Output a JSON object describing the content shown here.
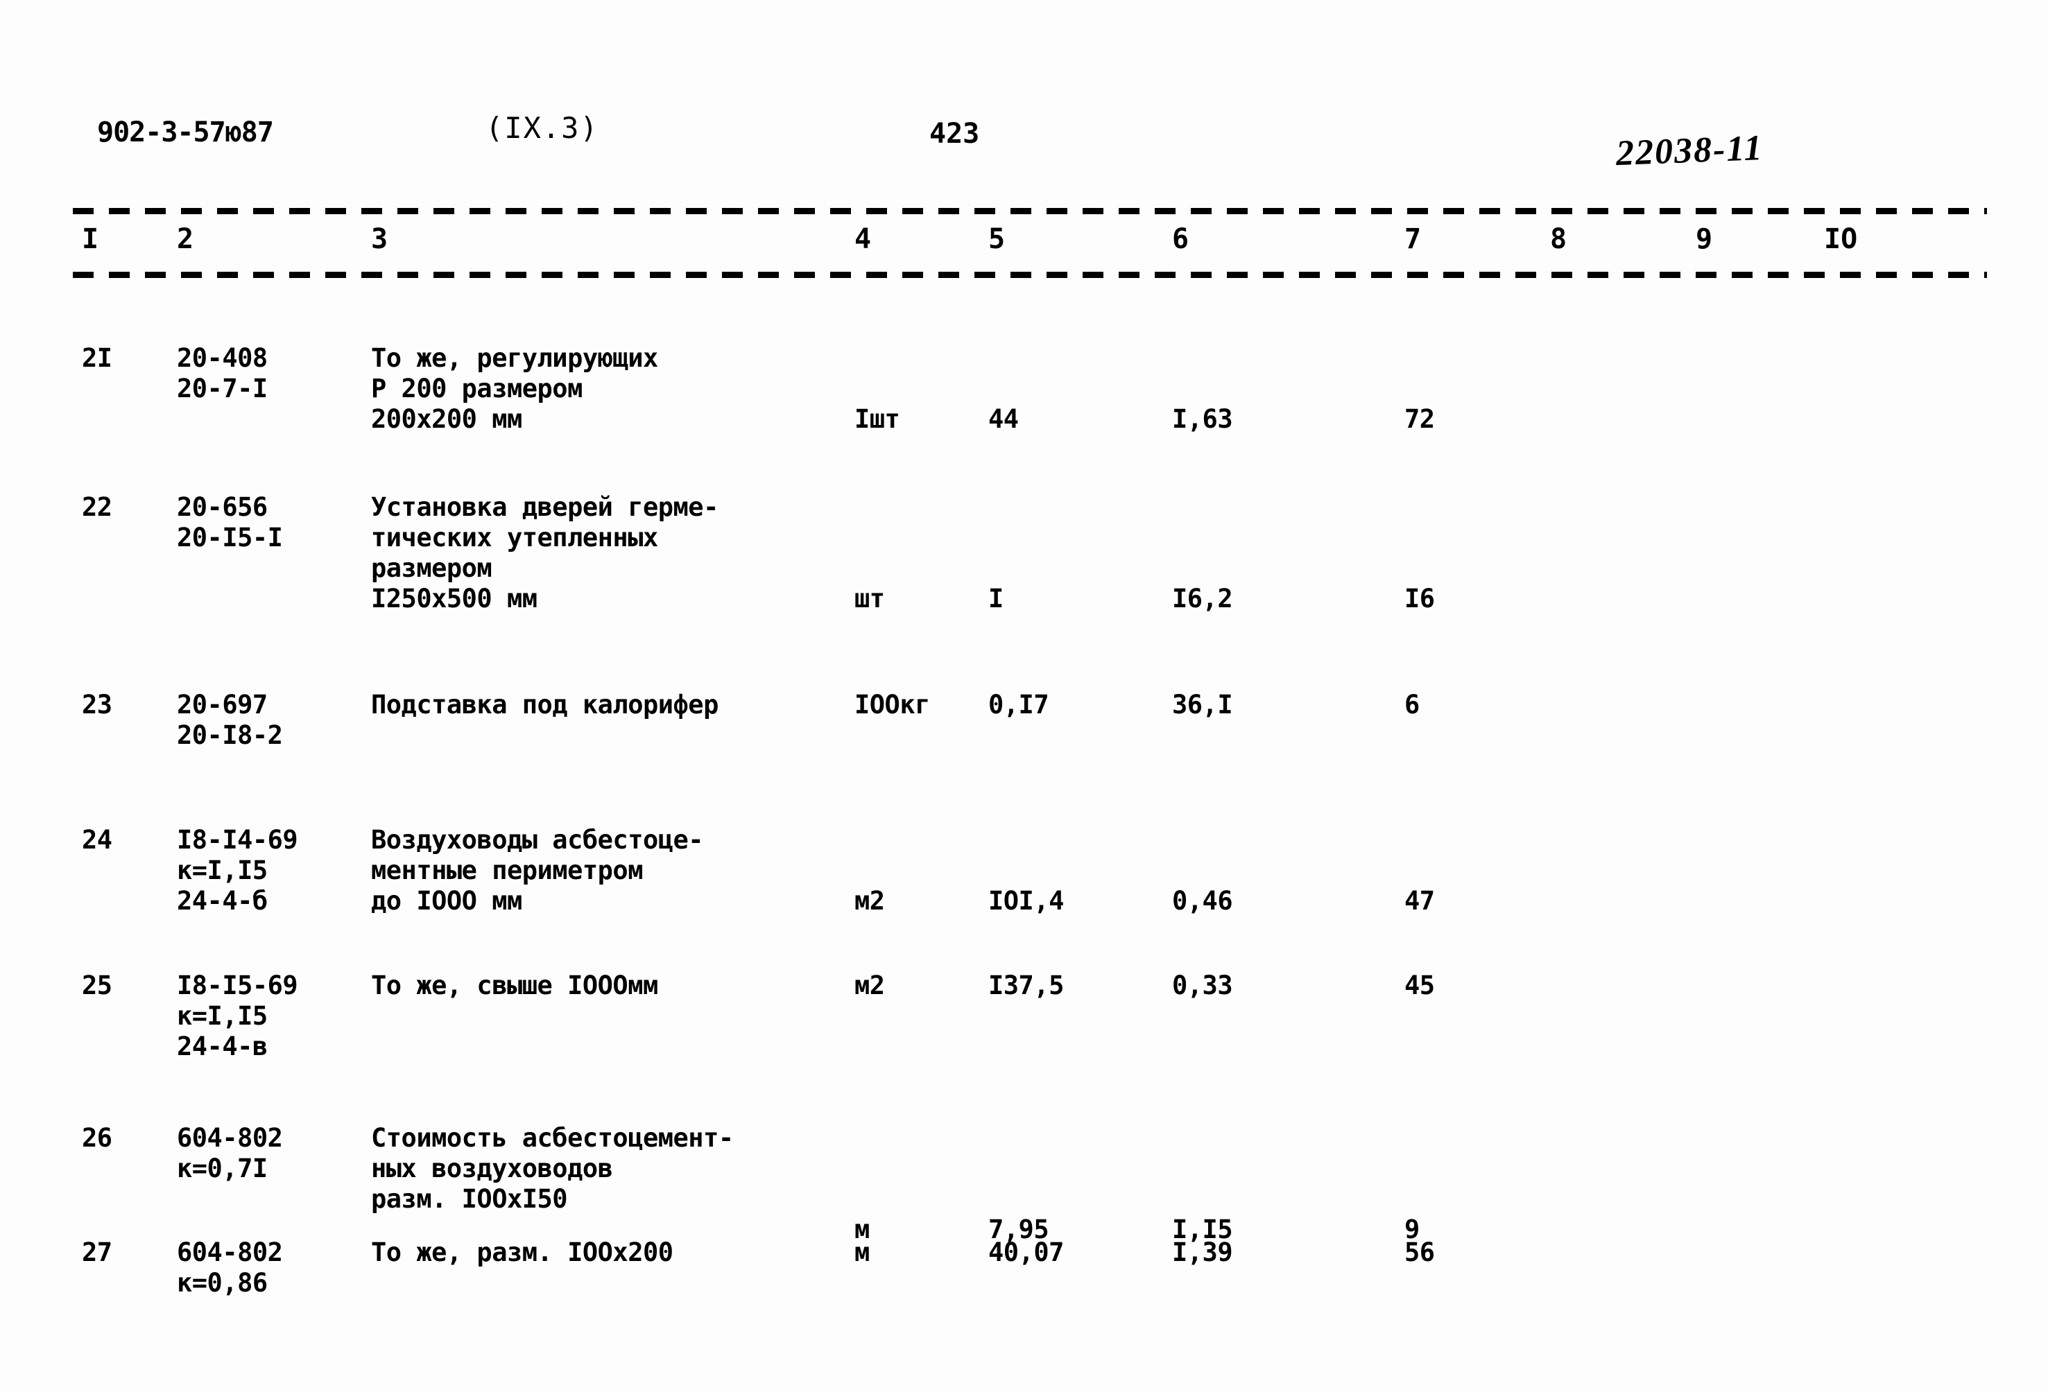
{
  "header": {
    "document_code": "902-3-57ю87",
    "section": "(IX.3)",
    "page_number": "423",
    "stamp": "22038-11"
  },
  "table": {
    "column_headers": [
      "I",
      "2",
      "3",
      "4",
      "5",
      "6",
      "7",
      "8",
      "9",
      "IO"
    ],
    "rows": [
      {
        "num": "2I",
        "code": "20-408\n20-7-I",
        "description": "То же, регулирующих\nР 200 размером\n200x200 мм",
        "unit": "Iшт",
        "qty": "44",
        "price": "I,63",
        "total": "72",
        "col8": "",
        "col9": "",
        "col10": ""
      },
      {
        "num": "22",
        "code": "20-656\n20-I5-I",
        "description": "Установка дверей герме-\nтических утепленных\nразмером\nI250x500 мм",
        "unit": "шт",
        "qty": "I",
        "price": "I6,2",
        "total": "I6",
        "col8": "",
        "col9": "",
        "col10": ""
      },
      {
        "num": "23",
        "code": "20-697\n20-I8-2",
        "description": "Подставка под калорифер",
        "unit": "IOOкг",
        "qty": "0,I7",
        "price": "36,I",
        "total": "6",
        "col8": "",
        "col9": "",
        "col10": ""
      },
      {
        "num": "24",
        "code": "I8-I4-69\nк=I,I5\n24-4-б",
        "description": "Воздуховоды асбестоце-\nментные периметром\nдо IOOO мм",
        "unit": "м2",
        "qty": "IOI,4",
        "price": "0,46",
        "total": "47",
        "col8": "",
        "col9": "",
        "col10": ""
      },
      {
        "num": "25",
        "code": "I8-I5-69\nк=I,I5\n24-4-в",
        "description": "То же, свыше IOOOмм",
        "unit": "м2",
        "qty": "I37,5",
        "price": "0,33",
        "total": "45",
        "col8": "",
        "col9": "",
        "col10": ""
      },
      {
        "num": "26",
        "code": "604-802\nк=0,7I",
        "description": "Стоимость асбестоцемент-\nных воздуховодов\nразм. IOOxI50",
        "unit": "м",
        "qty": "7,95",
        "price": "I,I5",
        "total": "9",
        "col8": "",
        "col9": "",
        "col10": ""
      },
      {
        "num": "27",
        "code": "604-802\nк=0,86",
        "description": "То же, разм. IOOx200",
        "unit": "м",
        "qty": "40,07",
        "price": "I,39",
        "total": "56",
        "col8": "",
        "col9": "",
        "col10": ""
      }
    ]
  },
  "layout": {
    "column_header_x": [
      118,
      255,
      535,
      1232,
      1425,
      1690,
      2025,
      2235,
      2445,
      2630
    ],
    "row_tops": [
      495,
      710,
      995,
      1190,
      1400,
      1620,
      1785
    ],
    "unit_offsets": [
      88,
      132,
      0,
      88,
      0,
      132,
      0
    ]
  }
}
